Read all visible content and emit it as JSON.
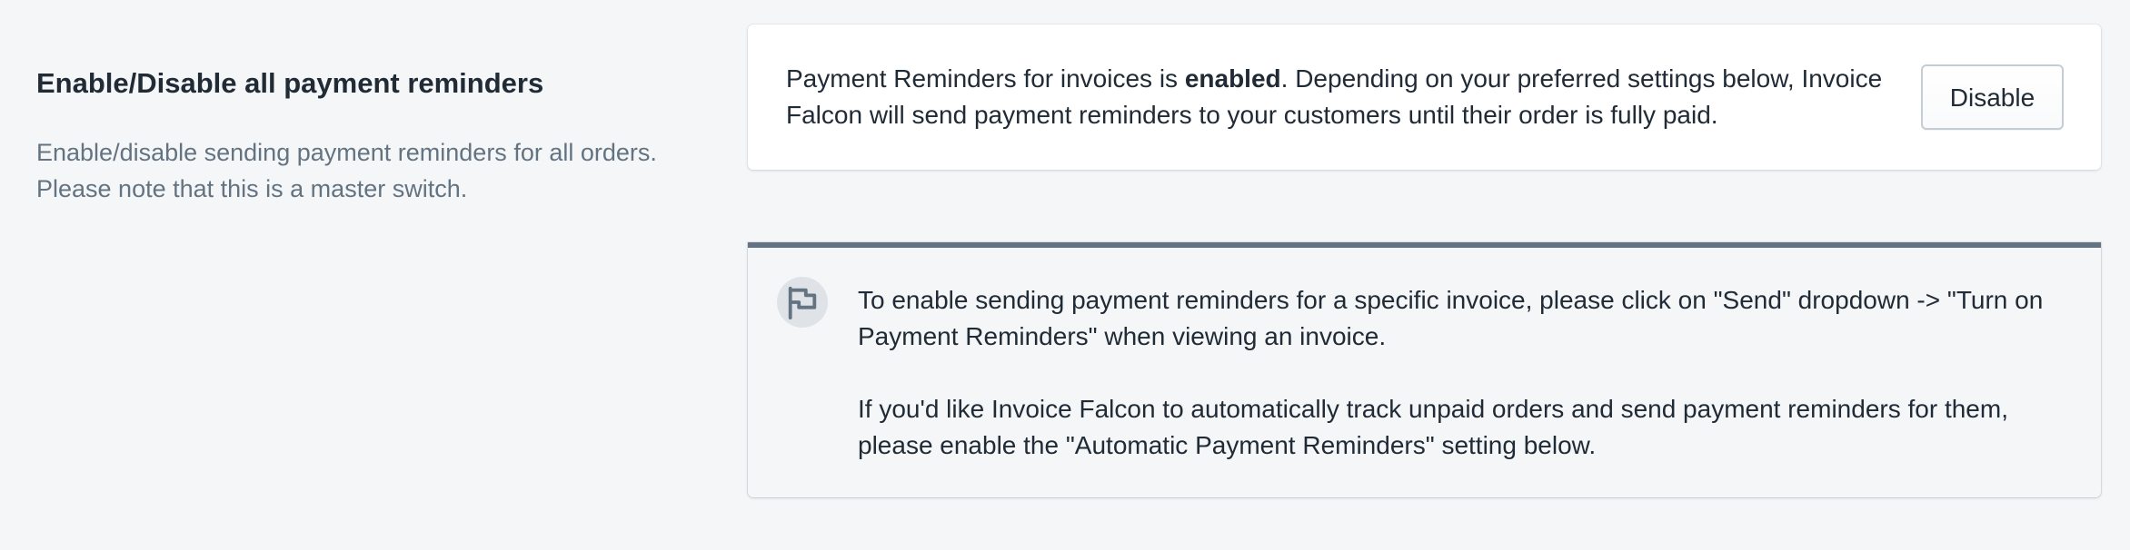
{
  "section": {
    "title": "Enable/Disable all payment reminders",
    "description": "Enable/disable sending payment reminders for all orders. Please note that this is a master switch."
  },
  "status_card": {
    "text_prefix": "Payment Reminders for invoices is ",
    "status_word": "enabled",
    "text_suffix": ". Depending on your preferred settings below, Invoice Falcon will send payment reminders to your customers until their order is fully paid.",
    "button_label": "Disable"
  },
  "info_banner": {
    "icon": "flag-icon",
    "paragraph_1": "To enable sending payment reminders for a specific invoice, please click on \"Send\" dropdown -> \"Turn on Payment Reminders\" when viewing an invoice.",
    "paragraph_2": "If you'd like Invoice Falcon to automatically track unpaid orders and send payment reminders for them, please enable the \"Automatic Payment Reminders\" setting below."
  }
}
